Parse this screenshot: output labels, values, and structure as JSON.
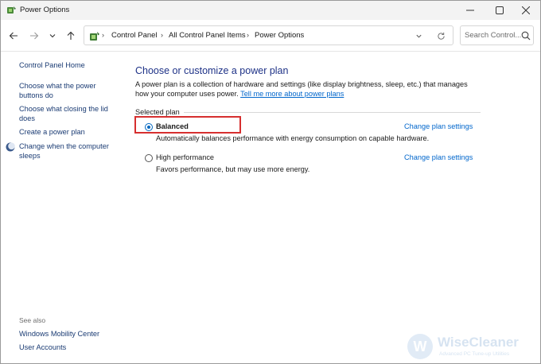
{
  "window": {
    "title": "Power Options"
  },
  "navigation": {
    "breadcrumbs": [
      "Control Panel",
      "All Control Panel Items",
      "Power Options"
    ],
    "search_placeholder": "Search Control..."
  },
  "sidebar": {
    "home": "Control Panel Home",
    "links": [
      "Choose what the power buttons do",
      "Choose what closing the lid does",
      "Create a power plan",
      "Change when the computer sleeps"
    ],
    "see_also_label": "See also",
    "see_also": [
      "Windows Mobility Center",
      "User Accounts"
    ]
  },
  "main": {
    "heading": "Choose or customize a power plan",
    "description": "A power plan is a collection of hardware and settings (like display brightness, sleep, etc.) that manages how your computer uses power.",
    "description_link": "Tell me more about power plans",
    "section_label": "Selected plan",
    "plans": [
      {
        "name": "Balanced",
        "description": "Automatically balances performance with energy consumption on capable hardware.",
        "link": "Change plan settings",
        "selected": true
      },
      {
        "name": "High performance",
        "description": "Favors performance, but may use more energy.",
        "link": "Change plan settings",
        "selected": false
      }
    ]
  },
  "watermark": {
    "logo_letter": "W",
    "name": "WiseCleaner",
    "tagline": "Advanced PC Tune-up Utilities"
  },
  "colors": {
    "link": "#0066cc",
    "heading": "#1e3287",
    "highlight": "#d62f2f"
  }
}
